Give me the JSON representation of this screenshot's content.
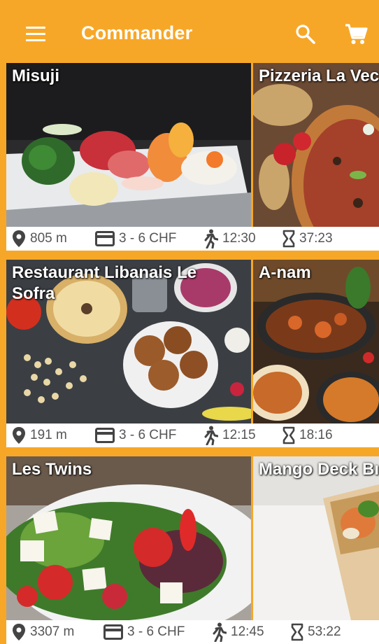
{
  "appbar": {
    "title": "Commander",
    "icons": {
      "menu": "menu-icon",
      "search": "search-icon",
      "cart": "cart-icon"
    },
    "color": "#f7a727"
  },
  "restaurants": [
    {
      "name": "Misuji",
      "distance": "805 m",
      "price": "3 - 6 CHF",
      "time": "12:30",
      "countdown": "37:23"
    },
    {
      "name": "Pizzeria La Vec"
    },
    {
      "name": "Restaurant Libanais Le Sofra",
      "distance": "191 m",
      "price": "3 - 6 CHF",
      "time": "12:15",
      "countdown": "18:16"
    },
    {
      "name": "A-nam"
    },
    {
      "name": "Les Twins",
      "distance": "3307 m",
      "price": "3 - 6 CHF",
      "time": "12:45",
      "countdown": "53:22"
    },
    {
      "name": "Mango Deck Bı"
    }
  ],
  "info_icons": [
    "location-pin-icon",
    "card-icon",
    "walking-icon",
    "hourglass-icon"
  ]
}
